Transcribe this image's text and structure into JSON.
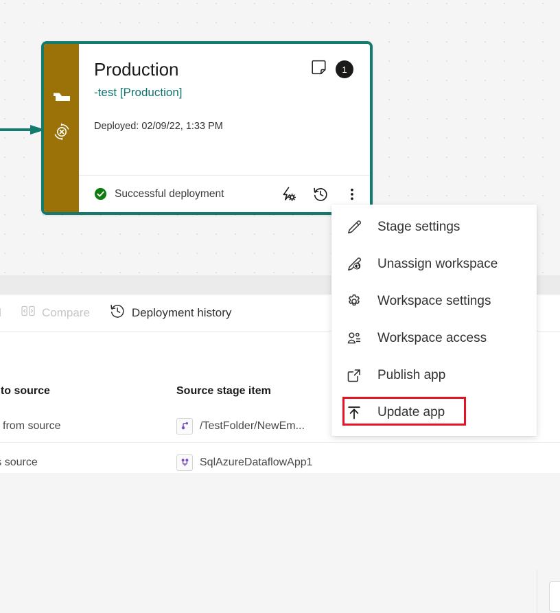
{
  "colors": {
    "card_border": "#137a6e",
    "rail": "#9b7208",
    "link": "#10726f",
    "success": "#107c10",
    "highlight": "#e81123",
    "badge_bg": "#1b1a19",
    "dataflow_icon": "#7a4fbf"
  },
  "arrow": {
    "name": "incoming-pipeline-arrow"
  },
  "stage_card": {
    "title": "Production",
    "workspace_link": "-test [Production]",
    "deployed_label": "Deployed: 02/09/22, 1:33 PM",
    "badge_count": "1",
    "note_icon": "sticky-note-icon",
    "rail_icons": [
      "flag-icon",
      "sync-error-icon"
    ],
    "status": {
      "icon": "success-check-icon",
      "text": "Successful deployment"
    },
    "footer_actions": [
      {
        "icon": "deployment-rules-icon",
        "name": "deployment-rules-button"
      },
      {
        "icon": "history-icon",
        "name": "deployment-history-button"
      },
      {
        "icon": "more-vertical-icon",
        "name": "more-options-button"
      }
    ]
  },
  "context_menu": {
    "items": [
      {
        "label": "Stage settings",
        "icon": "pencil-icon"
      },
      {
        "label": "Unassign workspace",
        "icon": "pencil-undo-icon"
      },
      {
        "label": "Workspace settings",
        "icon": "gear-icon"
      },
      {
        "label": "Workspace access",
        "icon": "people-icon"
      },
      {
        "label": "Publish app",
        "icon": "open-in-new-icon"
      },
      {
        "label": "Update app",
        "icon": "upload-arrow-icon"
      }
    ],
    "highlighted_item": "Update app"
  },
  "toolbar": {
    "items": [
      {
        "label": "related",
        "icon": "",
        "enabled": false
      },
      {
        "label": "Compare",
        "icon": "compare-icon",
        "enabled": false
      },
      {
        "label": "Deployment history",
        "icon": "history-icon",
        "enabled": true
      }
    ]
  },
  "table": {
    "headers": [
      "l to source",
      "Source stage item"
    ],
    "rows": [
      {
        "col_a": "rent from source",
        "col_b": "/TestFolder/NewEm...",
        "icon": "dataflow-icon"
      },
      {
        "col_a": "e as source",
        "col_b": "SqlAzureDataflowApp1",
        "icon": "dataflow-icon"
      }
    ]
  }
}
